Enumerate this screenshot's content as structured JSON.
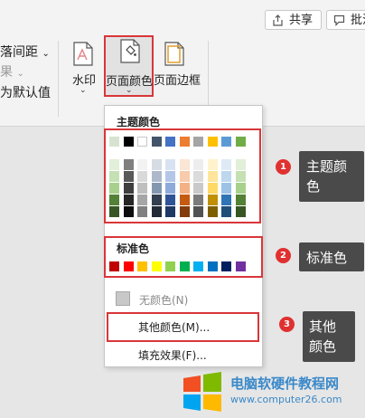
{
  "ribbon": {
    "share_label": "共享",
    "comment_label": "批注",
    "paragraph_spacing_label": "落间距",
    "effects_label": "果",
    "set_default_label": "为默认值",
    "watermark_label": "水印",
    "page_color_label": "页面颜色",
    "page_border_label": "页面边框"
  },
  "menu": {
    "theme_colors_label": "主题颜色",
    "standard_colors_label": "标准色",
    "no_color_label": "无颜色(N)",
    "more_colors_label": "其他颜色(M)...",
    "fill_effects_label": "填充效果(F)...",
    "theme_top_row": [
      "#d6e3d0",
      "#000000",
      "#ffffff",
      "#44546a",
      "#4472c4",
      "#ed7d31",
      "#a5a5a5",
      "#ffc000",
      "#5b9bd5",
      "#70ad47"
    ],
    "theme_shades": [
      [
        "#e2efd9",
        "#c5e0b3",
        "#a8d08d",
        "#538135",
        "#375623"
      ],
      [
        "#7f7f7f",
        "#595959",
        "#3f3f3f",
        "#262626",
        "#0d0d0d"
      ],
      [
        "#f2f2f2",
        "#d9d9d9",
        "#bfbfbf",
        "#a6a6a6",
        "#808080"
      ],
      [
        "#d6dce4",
        "#adb9ca",
        "#8497b0",
        "#333f50",
        "#222a35"
      ],
      [
        "#d9e2f3",
        "#b4c6e7",
        "#8eaadb",
        "#2f5496",
        "#1f3864"
      ],
      [
        "#fbe5d5",
        "#f7cbac",
        "#f4b183",
        "#c55a11",
        "#833c0b"
      ],
      [
        "#ededed",
        "#dbdbdb",
        "#c9c9c9",
        "#7b7b7b",
        "#525252"
      ],
      [
        "#fff2cc",
        "#fee599",
        "#ffd966",
        "#bf9000",
        "#7f6000"
      ],
      [
        "#deebf6",
        "#bdd7ee",
        "#9cc2e5",
        "#2e75b5",
        "#1f4e79"
      ],
      [
        "#e2efd9",
        "#c5e0b3",
        "#a8d08d",
        "#538135",
        "#375623"
      ]
    ],
    "standard_colors": [
      "#c00000",
      "#ff0000",
      "#ffc000",
      "#ffff00",
      "#92d050",
      "#00b050",
      "#00b0f0",
      "#0070c0",
      "#002060",
      "#7030a0"
    ]
  },
  "callouts": {
    "c1_number": "1",
    "c1_label": "主题颜色",
    "c2_number": "2",
    "c2_label": "标准色",
    "c3_number": "3",
    "c3_label": "其他颜色"
  },
  "watermark": {
    "site_name": "电脑软硬件教程网",
    "url": "www.computer26.com"
  },
  "colors": {
    "highlight": "#d9363a",
    "callout_bg": "#4a4a4a",
    "badge": "#e03131",
    "watermark_blue": "#3a89c9"
  }
}
